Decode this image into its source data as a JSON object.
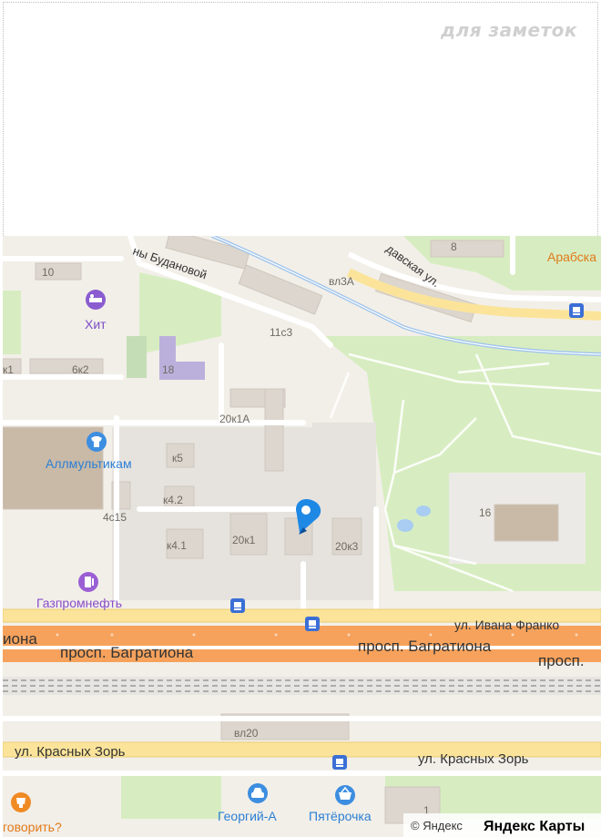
{
  "notes": {
    "label": "для заметок"
  },
  "map": {
    "streets": {
      "budanova": "ны Будановой",
      "davskaya": "давская ул.",
      "ivan_franko": "ул. Ивана Франко",
      "bagrationa_left": "иона",
      "bagrationa_1": "просп. Багратиона",
      "bagrationa_2": "просп. Багратиона",
      "bagrationa_right": "просп.",
      "krasnyh_zor_1": "ул. Красных Зорь",
      "krasnyh_zor_2": "ул. Красных Зорь"
    },
    "buildings": {
      "b8": "8",
      "b10": "10",
      "vl3a": "вл3А",
      "b11c3": "11с3",
      "k1": "к1",
      "b6k2": "6к2",
      "b18": "18",
      "b20k1a": "20к1А",
      "k5": "к5",
      "k4_2": "к4.2",
      "b4c15": "4с15",
      "k4_1": "к4.1",
      "b20k1": "20к1",
      "b20k3": "20к3",
      "b16": "16",
      "vl20": "вл20",
      "b1": "1"
    },
    "pois": {
      "arabska": "Арабска",
      "hit": "Хит",
      "allmultikam": "Аллмультикам",
      "gazpromneft": "Газпромнефть",
      "georgiy": "Георгий-А",
      "pyaterochka": "Пятёрочка",
      "govorit": "говорить?"
    },
    "copyright": "© Яндекс",
    "logo": "Яндекс Карты",
    "colors": {
      "road_major": "#f6a25c",
      "road_minor": "#fbe49a",
      "park": "#d7edc1",
      "water": "#a9cdf2",
      "building": "#dcd6ce",
      "pin": "#1e88e5"
    }
  }
}
